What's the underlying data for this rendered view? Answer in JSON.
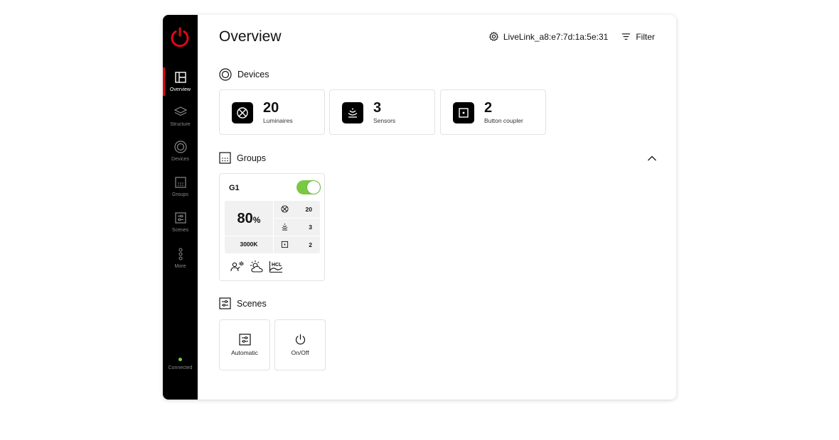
{
  "app": {
    "title": "Overview",
    "accent": "#e30613",
    "ok_color": "#7ac943"
  },
  "header": {
    "gateway": "LiveLink_a8:e7:7d:1a:5e:31",
    "filter": "Filter"
  },
  "sidebar": {
    "items": [
      {
        "label": "Overview",
        "icon": "layout-icon",
        "active": true
      },
      {
        "label": "Structure",
        "icon": "layers-icon"
      },
      {
        "label": "Devices",
        "icon": "target-icon"
      },
      {
        "label": "Groups",
        "icon": "grid-dots-icon"
      },
      {
        "label": "Scenes",
        "icon": "sliders-icon"
      },
      {
        "label": "More",
        "icon": "more-vertical-icon"
      }
    ],
    "status": "Connected"
  },
  "devices": {
    "heading": "Devices",
    "cards": [
      {
        "count": "20",
        "label": "Luminaires",
        "icon": "luminaire-icon"
      },
      {
        "count": "3",
        "label": "Sensors",
        "icon": "sensor-icon"
      },
      {
        "count": "2",
        "label": "Button coupler",
        "icon": "button-coupler-icon"
      }
    ]
  },
  "groups": {
    "heading": "Groups",
    "items": [
      {
        "name": "G1",
        "on": true,
        "brightness": "80",
        "unit": "%",
        "cct": "3000K",
        "luminaires": "20",
        "sensors": "3",
        "buttons": "2",
        "features": [
          "presence-daylight-icon",
          "daylight-icon",
          "hcl-icon"
        ],
        "hcl_text": "HCL"
      }
    ]
  },
  "scenes": {
    "heading": "Scenes",
    "items": [
      {
        "label": "Automatic",
        "icon": "sliders-icon"
      },
      {
        "label": "On/Off",
        "icon": "power-icon"
      }
    ]
  }
}
